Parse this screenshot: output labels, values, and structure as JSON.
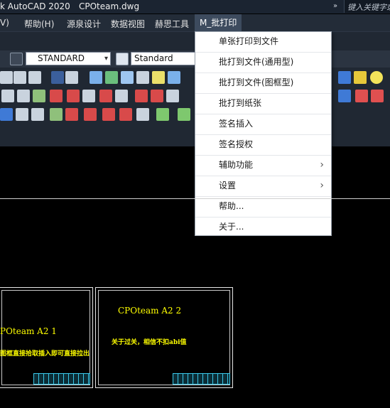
{
  "window": {
    "title": "k AutoCAD 2020",
    "filename": "CPOteam.dwg",
    "search_placeholder": "键入关键字或"
  },
  "menubar": {
    "items": [
      "V)",
      "帮助(H)",
      "源泉设计",
      "数据视图",
      "赫思工具"
    ],
    "active": "M_批打印"
  },
  "toolbar": {
    "text_style": "STANDARD",
    "dim_style": "Standard"
  },
  "dropdown": {
    "items": [
      {
        "label": "单张打印到文件",
        "submenu": false
      },
      {
        "label": "批打到文件(通用型)",
        "submenu": false
      },
      {
        "label": "批打到文件(图框型)",
        "submenu": false
      },
      {
        "label": "批打到纸张",
        "submenu": false
      },
      {
        "label": "签名插入",
        "submenu": false
      },
      {
        "label": "签名授权",
        "submenu": false
      },
      {
        "label": "辅助功能",
        "submenu": true
      },
      {
        "label": "设置",
        "submenu": true
      },
      {
        "label": "帮助...",
        "submenu": false
      },
      {
        "label": "关于...",
        "submenu": false
      }
    ]
  },
  "drawing": {
    "sheet1_title": "POteam A2 1",
    "sheet1_note": "图框直接拾取插入即可直接拉出",
    "sheet2_title": "CPOteam A2 2",
    "sheet2_note": "关于过关，相信不扣abi值"
  },
  "colors": {
    "cad_text": "#ffff00",
    "menu_active": "#3d4b5e",
    "title_block": "#39c7e8"
  }
}
